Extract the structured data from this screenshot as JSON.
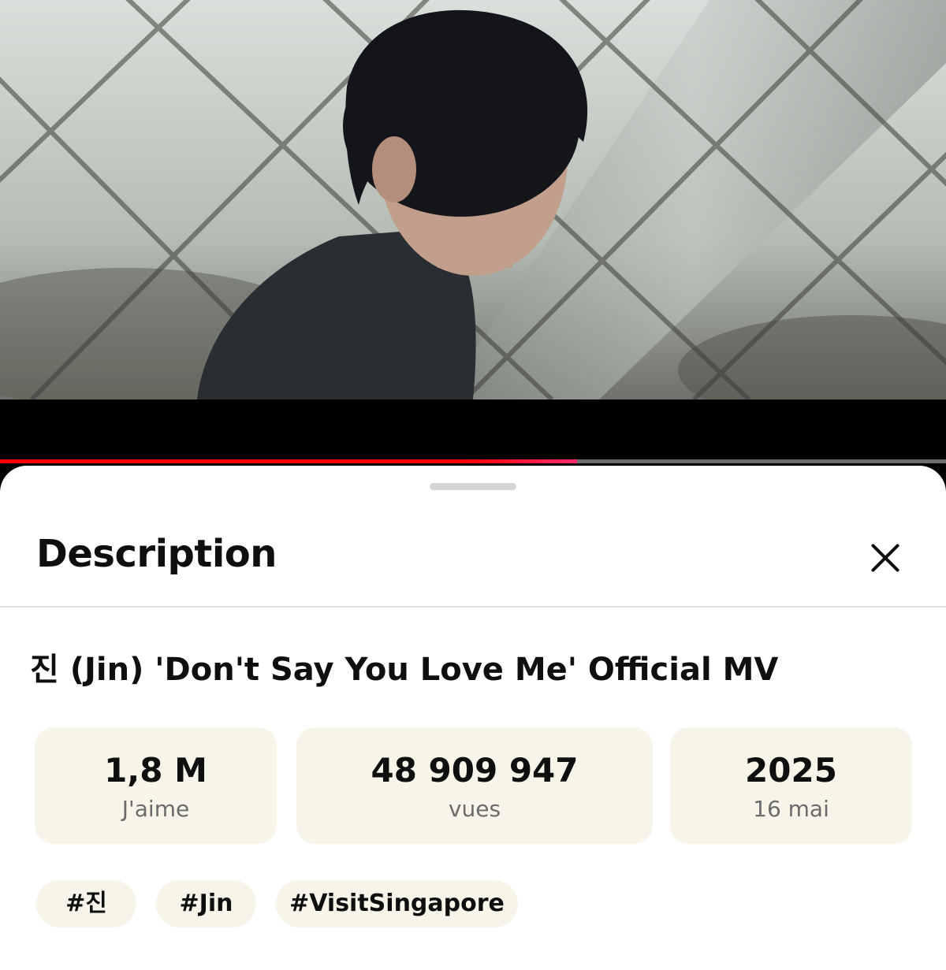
{
  "player": {
    "progress_fraction": 0.61,
    "progress_color": "#ff0000"
  },
  "description_panel": {
    "heading": "Description",
    "close_icon": "close-icon",
    "video_title": "진 (Jin) 'Don't Say You Love Me' Official MV",
    "stats": [
      {
        "value": "1,8 M",
        "label": "J'aime"
      },
      {
        "value": "48 909 947",
        "label": "vues"
      },
      {
        "value": "2025",
        "label": "16 mai"
      }
    ],
    "hashtags": [
      "#진",
      "#Jin",
      "#VisitSingapore"
    ]
  },
  "colors": {
    "chip_background": "#f7f4e8",
    "sheet_background": "#ffffff"
  }
}
